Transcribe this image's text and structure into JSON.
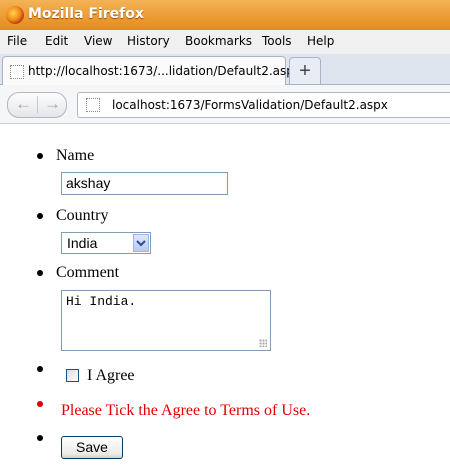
{
  "window": {
    "title": "Mozilla Firefox"
  },
  "menu": [
    "File",
    "Edit",
    "View",
    "History",
    "Bookmarks",
    "Tools",
    "Help"
  ],
  "tab": {
    "label": "http://localhost:1673/...lidation/Default2.aspx",
    "new_tab_symbol": "+"
  },
  "nav": {
    "back_icon": "back-arrow-icon",
    "forward_icon": "forward-arrow-icon",
    "url": "localhost:1673/FormsValidation/Default2.aspx"
  },
  "form": {
    "name_label": "Name",
    "name_value": "akshay",
    "country_label": "Country",
    "country_value": "India",
    "comment_label": "Comment",
    "comment_value": "Hi India.",
    "agree_label": "I Agree",
    "agree_checked": false,
    "error_message": "Please Tick the Agree to Terms of Use.",
    "save_label": "Save"
  },
  "colors": {
    "titlebar": "#e58a1c",
    "error": "#e00000",
    "input_border": "#7f9db9"
  }
}
